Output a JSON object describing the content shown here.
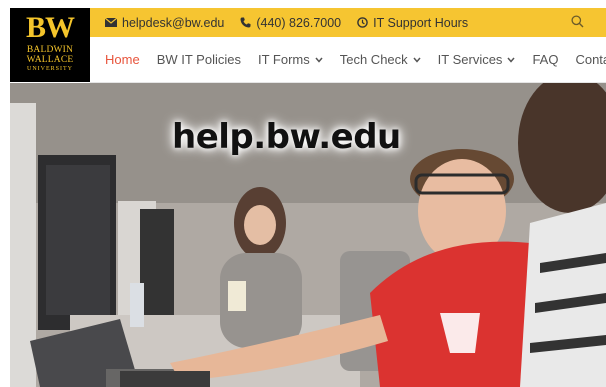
{
  "logo": {
    "mark": "BW",
    "line1": "BALDWIN",
    "line2": "WALLACE",
    "line3": "UNIVERSITY"
  },
  "topbar": {
    "email": "helpdesk@bw.edu",
    "phone": "(440) 826.7000",
    "hours": "IT Support Hours",
    "email_icon": "envelope-icon",
    "phone_icon": "phone-icon",
    "hours_icon": "clock-icon",
    "search_icon": "search-icon"
  },
  "nav": {
    "items": [
      {
        "label": "Home",
        "active": true
      },
      {
        "label": "BW IT Policies"
      },
      {
        "label": "IT Forms",
        "dropdown": true
      },
      {
        "label": "Tech Check",
        "dropdown": true
      },
      {
        "label": "IT Services",
        "dropdown": true
      },
      {
        "label": "FAQ"
      },
      {
        "label": "Contact"
      }
    ]
  },
  "hero": {
    "text": "help.bw.edu"
  },
  "colors": {
    "gold": "#f6c531",
    "accent": "#e8553d",
    "logo_bg": "#000000"
  }
}
